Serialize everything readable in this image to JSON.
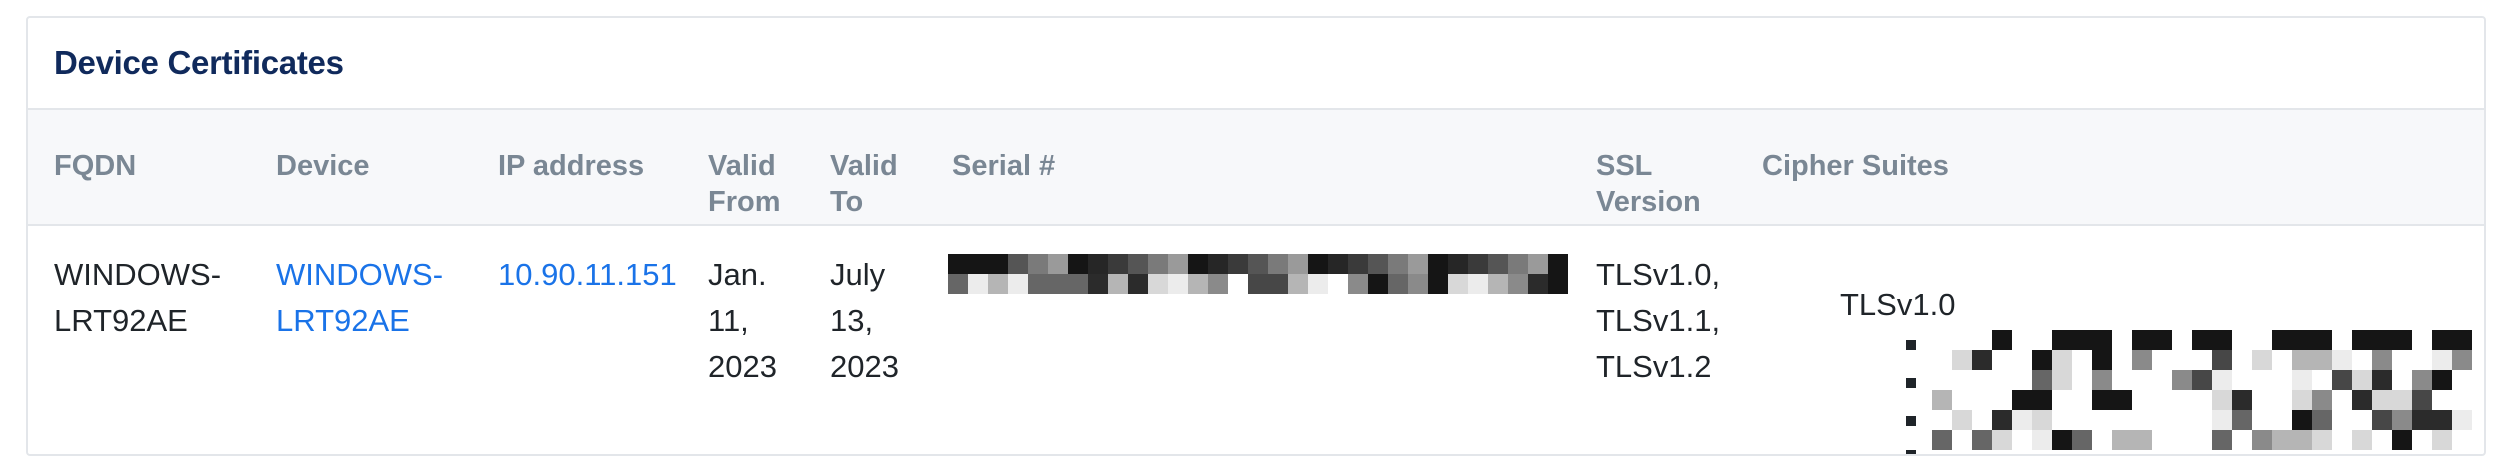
{
  "card": {
    "title": "Device Certificates"
  },
  "table": {
    "headers": {
      "fqdn": "FQDN",
      "device": "Device",
      "ip": "IP address",
      "valid_from": "Valid\nFrom",
      "valid_to": "Valid\nTo",
      "serial": "Serial #",
      "ssl_version": "SSL\nVersion",
      "cipher_suites": "Cipher Suites"
    },
    "rows": [
      {
        "fqdn": "WINDOWS-\nLRT92AE",
        "device": "WINDOWS-\nLRT92AE",
        "ip": "10.90.11.151",
        "valid_from": "Jan.\n11,\n2023",
        "valid_to": "July\n13,\n2023",
        "ssl_version": "TLSv1.0,\nTLSv1.1,\nTLSv1.2",
        "cipher_group_label": "TLSv1.0"
      }
    ]
  },
  "colors": {
    "title": "#102a5c",
    "header_text": "#7a8794",
    "link": "#1a73e8",
    "header_bg": "#f7f8fa",
    "border": "#e3e6ea"
  }
}
